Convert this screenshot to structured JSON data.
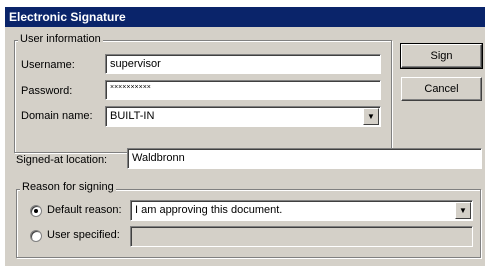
{
  "window": {
    "title": "Electronic Signature"
  },
  "user_info": {
    "legend": "User information",
    "username_label": "Username:",
    "username_value": "supervisor",
    "password_label": "Password:",
    "password_value": "××××××××××",
    "domain_label": "Domain name:",
    "domain_value": "BUILT-IN"
  },
  "buttons": {
    "sign_label": "Sign",
    "cancel_label": "Cancel"
  },
  "location": {
    "label": "Signed-at location:",
    "value": "Waldbronn"
  },
  "reason": {
    "legend": "Reason for signing",
    "default_label": "Default reason:",
    "default_value": "I am approving this document.",
    "default_selected": true,
    "user_label": "User specified:",
    "user_value": ""
  },
  "icons": {
    "dropdown": "triangle-down-icon",
    "radio_selected": "radio-dot-icon"
  }
}
